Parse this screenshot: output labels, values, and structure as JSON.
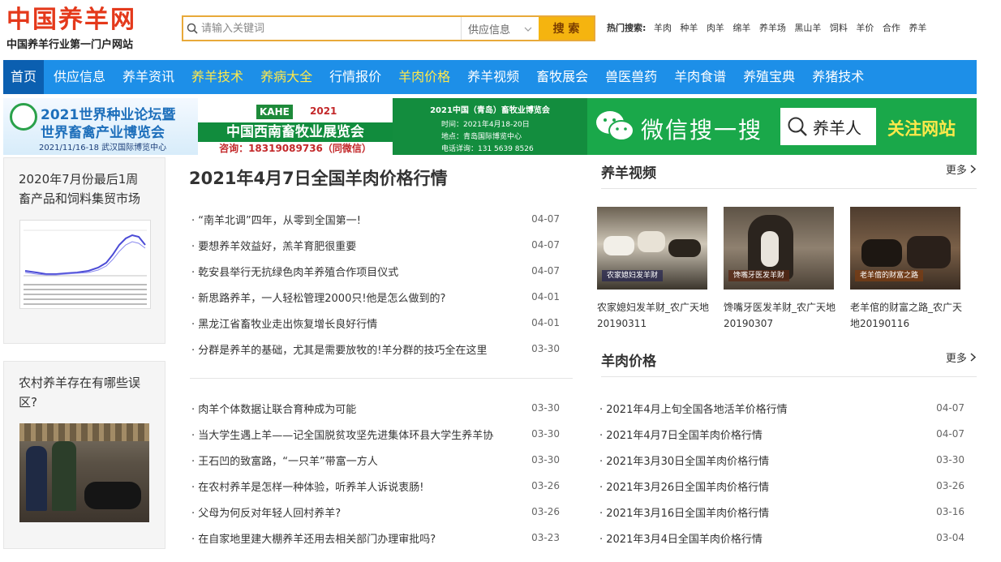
{
  "site": {
    "title": "中国养羊网",
    "subtitle": "中国养羊行业第一门户网站"
  },
  "search": {
    "placeholder": "请输入关键词",
    "category": "供应信息",
    "button": "搜 索"
  },
  "hot": {
    "label": "热门搜索:",
    "keywords": [
      "羊肉",
      "种羊",
      "肉羊",
      "绵羊",
      "养羊场",
      "黑山羊",
      "饲料",
      "羊价",
      "合作",
      "养羊"
    ]
  },
  "nav": [
    "首页",
    "供应信息",
    "养羊资讯",
    "养羊技术",
    "养病大全",
    "行情报价",
    "羊肉价格",
    "养羊视频",
    "畜牧展会",
    "兽医兽药",
    "羊肉食谱",
    "养殖宝典",
    "养猪技术"
  ],
  "banners": {
    "b1": {
      "line1": "2021世界种业论坛暨",
      "line2": "世界畜禽产业博览会",
      "line3": "2021/11/16-18  武汉国际博览中心"
    },
    "b2": {
      "brand": "KAHE",
      "year": "2021",
      "name": "中国西南畜牧业展览会",
      "contact": "咨询：18319089736（同微信）"
    },
    "b3": {
      "title": "2021中国（青岛）畜牧业博览会",
      "time": "时间：2021年4月18-20日",
      "place": "地点：青岛国际博览中心",
      "phone": "电话详询：131 5639 8526"
    },
    "b4": {
      "text": "微信搜一搜",
      "box": "养羊人",
      "follow": "关注网站"
    }
  },
  "left": {
    "card1": {
      "title": "2020年7月份最后1周畜产品和饲料集贸市场"
    },
    "card2": {
      "title": "农村养羊存在有哪些误区?"
    }
  },
  "main": {
    "title": "2021年4月7日全国羊肉价格行情",
    "list1": [
      {
        "text": "“南羊北调”四年，从零到全国第一!",
        "date": "04-07"
      },
      {
        "text": "要想养羊效益好，羔羊育肥很重要",
        "date": "04-07"
      },
      {
        "text": "乾安县举行无抗绿色肉羊养殖合作项目仪式",
        "date": "04-07"
      },
      {
        "text": "新思路养羊，一人轻松管理2000只!他是怎么做到的?",
        "date": "04-01"
      },
      {
        "text": "黑龙江省畜牧业走出恢复增长良好行情",
        "date": "04-01"
      },
      {
        "text": "分群是养羊的基础，尤其是需要放牧的!羊分群的技巧全在这里",
        "date": "03-30"
      }
    ],
    "list2": [
      {
        "text": "肉羊个体数据让联合育种成为可能",
        "date": "03-30"
      },
      {
        "text": "当大学生遇上羊——记全国脱贫攻坚先进集体环县大学生养羊协",
        "date": "03-30"
      },
      {
        "text": "王石凹的致富路，“一只羊”带富一方人",
        "date": "03-30"
      },
      {
        "text": "在农村养羊是怎样一种体验，听养羊人诉说衷肠!",
        "date": "03-26"
      },
      {
        "text": "父母为何反对年轻人回村养羊?",
        "date": "03-26"
      },
      {
        "text": "在自家地里建大棚养羊还用去相关部门办理审批吗?",
        "date": "03-23"
      }
    ]
  },
  "videos": {
    "heading": "养羊视频",
    "more": "更多",
    "items": [
      {
        "caption": "农家媳妇发羊财_农广天地20190311",
        "strip": "农家媳妇发羊财"
      },
      {
        "caption": "馋嘴牙医发羊财_农广天地20190307",
        "strip": "馋嘴牙医发羊财"
      },
      {
        "caption": "老羊倌的财富之路_农广天地20190116",
        "strip": "老羊倌的财富之路"
      }
    ]
  },
  "prices": {
    "heading": "羊肉价格",
    "more": "更多",
    "items": [
      {
        "text": "2021年4月上旬全国各地活羊价格行情",
        "date": "04-07"
      },
      {
        "text": "2021年4月7日全国羊肉价格行情",
        "date": "04-07"
      },
      {
        "text": "2021年3月30日全国羊肉价格行情",
        "date": "03-30"
      },
      {
        "text": "2021年3月26日全国羊肉价格行情",
        "date": "03-26"
      },
      {
        "text": "2021年3月16日全国羊肉价格行情",
        "date": "03-16"
      },
      {
        "text": "2021年3月4日全国羊肉价格行情",
        "date": "03-04"
      }
    ]
  },
  "colors": {
    "brand": "#e4391b",
    "nav": "#1d8fe8",
    "navActive": "#0b5fb0",
    "navHighlight": "#ffe94a",
    "searchButton": "#f5b40f"
  }
}
